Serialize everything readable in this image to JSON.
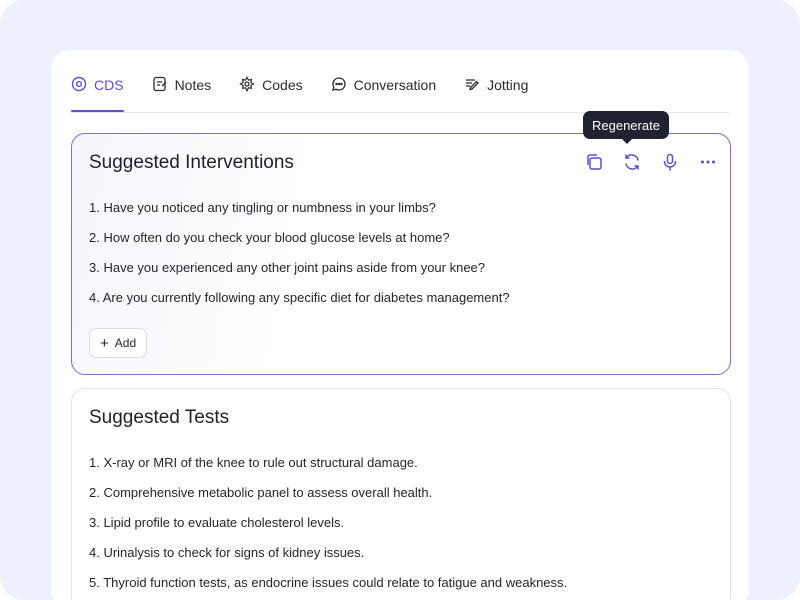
{
  "tabs": [
    {
      "label": "CDS",
      "icon": "cds-icon",
      "active": true
    },
    {
      "label": "Notes",
      "icon": "notes-icon",
      "active": false
    },
    {
      "label": "Codes",
      "icon": "codes-icon",
      "active": false
    },
    {
      "label": "Conversation",
      "icon": "conversation-icon",
      "active": false
    },
    {
      "label": "Jotting",
      "icon": "jotting-icon",
      "active": false
    }
  ],
  "tooltip": "Regenerate",
  "interventions": {
    "title": "Suggested Interventions",
    "items": [
      "1. Have you noticed any tingling or numbness in your limbs?",
      "2. How often do you check your blood glucose levels at home?",
      "3. Have you experienced any other joint pains aside from your knee?",
      "4. Are you currently following any specific diet for diabetes management?"
    ],
    "add_label": "Add"
  },
  "tests": {
    "title": "Suggested Tests",
    "items": [
      "1. X-ray or MRI of the knee to rule out structural damage.",
      "2. Comprehensive metabolic panel to assess overall health.",
      "3. Lipid profile to evaluate cholesterol levels.",
      "4. Urinalysis to check for signs of kidney issues.",
      "5. Thyroid function tests, as endocrine issues could relate to fatigue and weakness."
    ]
  },
  "colors": {
    "accent": "#5b4fd4",
    "frame_bg": "#eef0fd",
    "tooltip_bg": "#1f2230"
  }
}
